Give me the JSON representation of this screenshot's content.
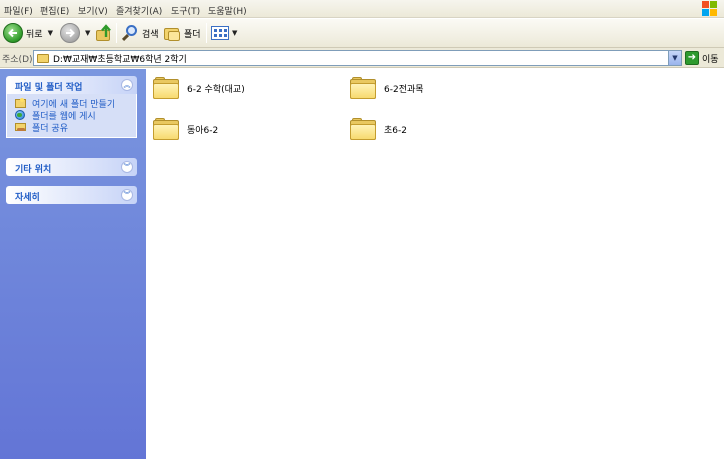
{
  "menu": [
    "파일(F)",
    "편집(E)",
    "보기(V)",
    "즐겨찾기(A)",
    "도구(T)",
    "도움말(H)"
  ],
  "toolbar": {
    "back_label": "뒤로",
    "search_label": "검색",
    "folders_label": "폴더"
  },
  "address": {
    "label": "주소(D)",
    "path": "D:₩교재₩초등학교₩6학년 2학기",
    "go_label": "이동"
  },
  "tasks": {
    "file_folder_title": "파일 및 폴더 작업",
    "items": [
      "여기에 새 폴더 만들기",
      "폴더를 웹에 게시",
      "폴더 공유"
    ],
    "other_places_title": "기타 위치",
    "details_title": "자세히"
  },
  "folders": [
    "6-2 수학(대교)",
    "6-2전과목",
    "동아6-2",
    "초6-2"
  ],
  "colors": {
    "taskpane_top": "#7a96df",
    "taskpane_bottom": "#6375d6",
    "link_blue": "#215dc6"
  }
}
